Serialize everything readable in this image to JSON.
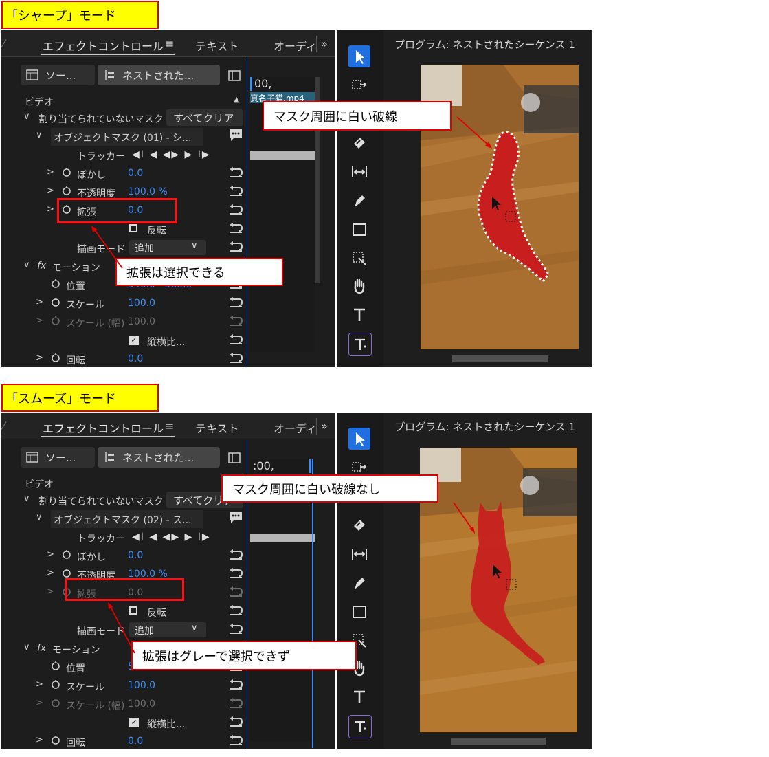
{
  "top": {
    "mode_label": "「シャープ」モード",
    "tabs": {
      "effects": "エフェクトコントロール",
      "menu": "≡",
      "text": "テキスト",
      "audio": "オーディ",
      "more": "»"
    },
    "clip_source": "ソー...",
    "clip_nested": "ネストされた...",
    "timecode": "00,",
    "clip_name": "真名子猫.mp4",
    "video_header": "ビデオ",
    "unassigned_mask": "割り当てられていないマスク",
    "clear_all": "すべてクリア",
    "object_mask": "オブジェクトマスク (01) - シ...",
    "tracker_label": "トラッカー",
    "tracker_buttons": "◀I ◀ ◀▶ ▶ I▶",
    "blur_label": "ぼかし",
    "blur_value": "0.0",
    "opacity_label": "不透明度",
    "opacity_value": "100.0 %",
    "expand_label": "拡張",
    "expand_value": "0.0",
    "invert_label": "反転",
    "draw_mode_label": "描画モード",
    "draw_mode_value": "追加",
    "fx_label": "fx",
    "motion_label": "モーション",
    "position_label": "位置",
    "position_value": "540.0   960.0",
    "scale_label": "スケール",
    "scale_value": "100.0",
    "scale_width_label": "スケール (幅)",
    "scale_width_value": "100.0",
    "uniform_label": "縦横比...",
    "rotation_label": "回転",
    "rotation_value": "0.0",
    "program_title": "プログラム: ネストされたシーケンス 1",
    "callout_mask": "マスク周囲に白い破線",
    "callout_expand": "拡張は選択できる"
  },
  "bottom": {
    "mode_label": "「スムーズ」モード",
    "tabs": {
      "effects": "エフェクトコントロール",
      "menu": "≡",
      "text": "テキスト",
      "audio": "オーディ",
      "more": "»"
    },
    "clip_source": "ソー...",
    "clip_nested": "ネストされた...",
    "timecode": ":00,",
    "video_header": "ビデオ",
    "unassigned_mask": "割り当てられていないマスク",
    "clear_all": "すべてクリア",
    "object_mask": "オブジェクトマスク (02) - ス...",
    "tracker_label": "トラッカー",
    "tracker_buttons": "◀I ◀ ◀▶ ▶ I▶",
    "blur_label": "ぼかし",
    "blur_value": "0.0",
    "opacity_label": "不透明度",
    "opacity_value": "100.0 %",
    "expand_label": "拡張",
    "expand_value": "0.0",
    "invert_label": "反転",
    "draw_mode_label": "描画モード",
    "draw_mode_value": "追加",
    "fx_label": "fx",
    "motion_label": "モーション",
    "position_label": "位置",
    "position_value": "540.0   960.0",
    "scale_label": "スケール",
    "scale_value": "100.0",
    "scale_width_label": "スケール (幅)",
    "scale_width_value": "100.0",
    "uniform_label": "縦横比...",
    "rotation_label": "回転",
    "rotation_value": "0.0",
    "program_title": "プログラム: ネストされたシーケンス 1",
    "callout_mask": "マスク周囲に白い破線なし",
    "callout_expand": "拡張はグレーで選択できず"
  },
  "colors": {
    "accent": "#3e8ef7",
    "callout_border": "#e00000",
    "mode_bg": "#ffff00",
    "mask": "#c81e1e"
  },
  "icons": [
    "grid-icon",
    "nest-icon",
    "panel-icon",
    "stopwatch-icon",
    "reset-icon",
    "chat-icon",
    "dropdown-chevron-icon",
    "selection-tool-icon",
    "track-select-icon",
    "razor-icon",
    "slip-icon",
    "pen-icon",
    "rectangle-icon",
    "hand-icon",
    "type-icon",
    "generative-icon",
    "checkbox-icon"
  ]
}
